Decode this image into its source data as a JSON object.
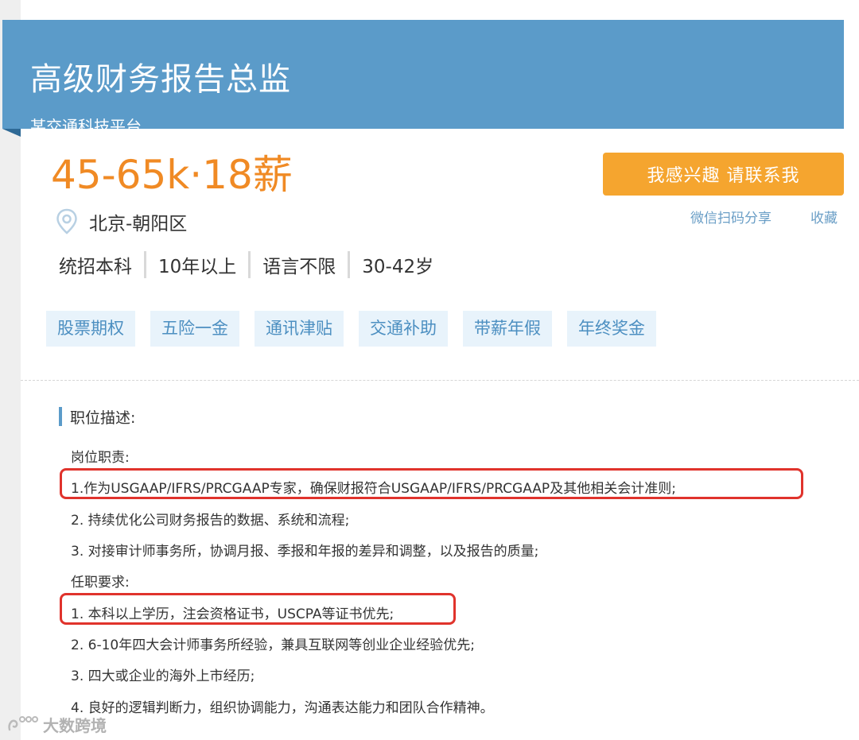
{
  "header": {
    "title": "高级财务报告总监",
    "company": "某交通科技平台"
  },
  "job": {
    "salary": "45-65k·18薪",
    "location": "北京-朝阳区",
    "requirements": [
      "统招本科",
      "10年以上",
      "语言不限",
      "30-42岁"
    ],
    "benefits": [
      "股票期权",
      "五险一金",
      "通讯津贴",
      "交通补助",
      "带薪年假",
      "年终奖金"
    ]
  },
  "actions": {
    "contact_label": "我感兴趣 请联系我",
    "share_label": "微信扫码分享",
    "favorite_label": "收藏"
  },
  "description": {
    "heading": "职位描述:",
    "duties_title": "岗位职责:",
    "duties": [
      "1.作为USGAAP/IFRS/PRCGAAP专家，确保财报符合USGAAP/IFRS/PRCGAAP及其他相关会计准则;",
      "2. 持续优化公司财务报告的数据、系统和流程;",
      "3. 对接审计师事务所，协调月报、季报和年报的差异和调整，以及报告的质量;"
    ],
    "requirements_title": "任职要求:",
    "requirements": [
      "1. 本科以上学历，注会资格证书，USCPA等证书优先;",
      "2. 6-10年四大会计师事务所经验，兼具互联网等创业企业经验优先;",
      "3. 四大或企业的海外上市经历;",
      "4. 良好的逻辑判断力，组织协调能力，沟通表达能力和团队合作精神。"
    ]
  },
  "watermark": {
    "text": "大数跨境"
  },
  "colors": {
    "header_bg": "#5b9bc9",
    "salary": "#f08a24",
    "button": "#f5a52f",
    "link": "#6a9ec6",
    "tag_bg": "#e8f3fb",
    "tag_text": "#4c8fc1",
    "highlight": "#e0332c"
  },
  "icons": {
    "location": "location-pin-icon",
    "watermark": "watermark-logo-icon"
  }
}
